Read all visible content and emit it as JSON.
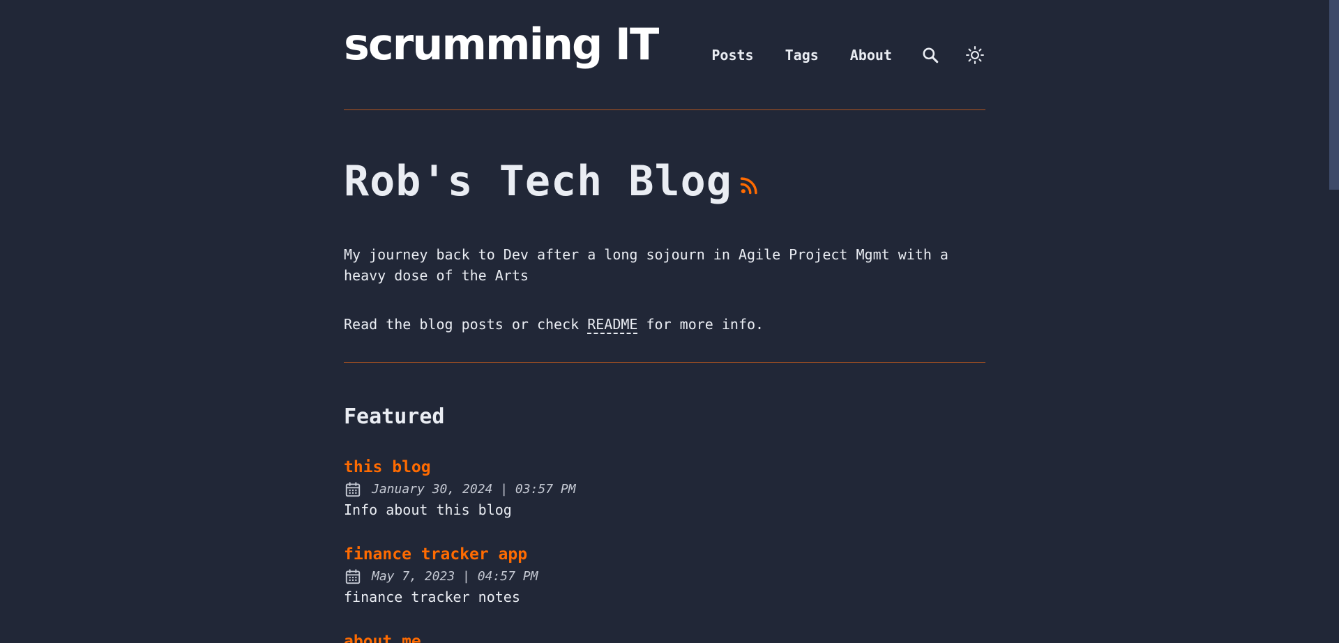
{
  "header": {
    "logo": "scrumming IT",
    "nav": [
      "Posts",
      "Tags",
      "About"
    ],
    "search_icon": "search-icon",
    "theme_icon": "sun-icon"
  },
  "hero": {
    "title": "Rob's Tech Blog",
    "rss_icon": "rss-icon",
    "description": "My journey back to Dev after a long sojourn in Agile Project Mgmt with a heavy dose of the Arts",
    "readme_prefix": "Read the blog posts or check ",
    "readme_link": "README",
    "readme_suffix": " for more info."
  },
  "featured": {
    "heading": "Featured",
    "posts": [
      {
        "title": "this blog",
        "date": "January 30, 2024 | 03:57 PM",
        "description": "Info about this blog"
      },
      {
        "title": "finance tracker app",
        "date": "May 7, 2023 | 04:57 PM",
        "description": "finance tracker notes"
      },
      {
        "title": "about me",
        "date": "",
        "description": ""
      }
    ]
  },
  "colors": {
    "background": "#212737",
    "accent": "#ff6b01",
    "text": "#eaedf3",
    "divider": "#b4561f"
  }
}
